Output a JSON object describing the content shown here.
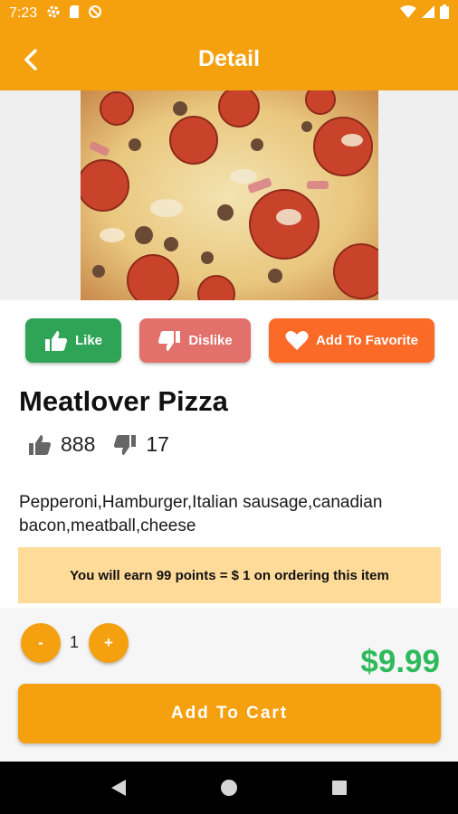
{
  "status_bar": {
    "time": "7:23"
  },
  "app_bar": {
    "title": "Detail"
  },
  "actions": {
    "like_label": "Like",
    "dislike_label": "Dislike",
    "favorite_label": "Add To Favorite"
  },
  "product": {
    "name": "Meatlover Pizza",
    "likes": "888",
    "dislikes": "17",
    "description": "Pepperoni,Hamburger,Italian sausage,canadian bacon,meatball,cheese",
    "points_message": "You will earn 99 points = $ 1 on ordering this item",
    "price": "$9.99"
  },
  "cart": {
    "minus_label": "-",
    "plus_label": "+",
    "quantity": "1",
    "add_to_cart_label": "Add To Cart"
  },
  "colors": {
    "primary": "#f5a00f",
    "like": "#2fa456",
    "dislike": "#e2706b",
    "favorite": "#fb6a27",
    "price": "#2fba5c",
    "banner": "#ffdb9a"
  },
  "icons": {
    "status": [
      "settings-icon",
      "sd-card-icon",
      "no-disturb-icon",
      "wifi-icon",
      "signal-icon",
      "battery-icon"
    ],
    "nav": [
      "back-triangle-icon",
      "home-circle-icon",
      "recents-square-icon"
    ]
  }
}
